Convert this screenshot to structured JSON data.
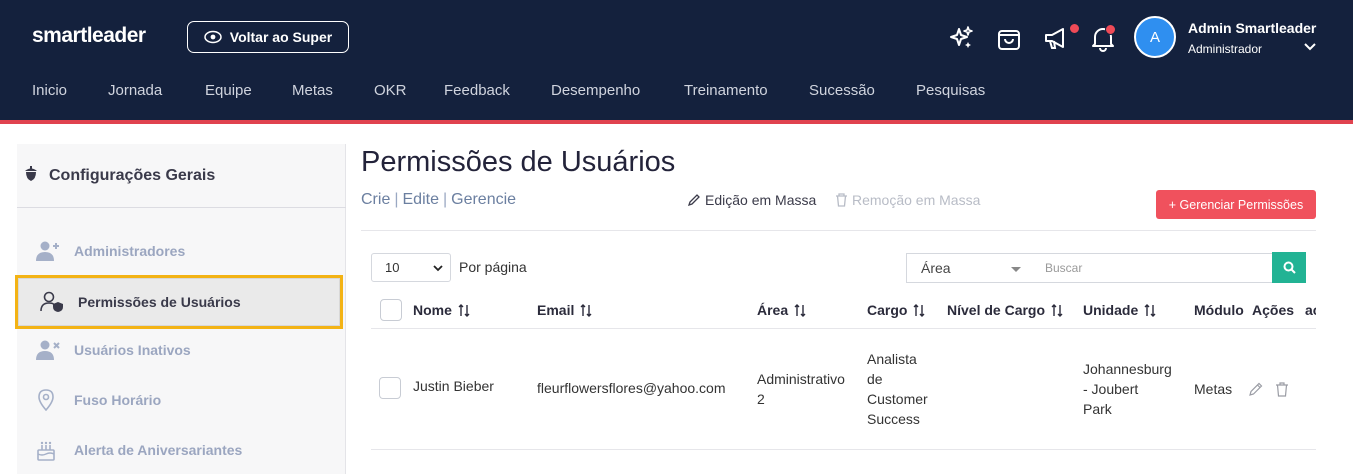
{
  "header": {
    "logo": "smartleader",
    "back_button": "Voltar ao Super",
    "icons": [
      "sparkle-icon",
      "shopping-bag-icon",
      "megaphone-icon",
      "bell-icon"
    ],
    "notification_color": "#ef4a57",
    "user": {
      "initial": "A",
      "name": "Admin Smartleader",
      "role": "Administrador"
    }
  },
  "nav": [
    "Inicio",
    "Jornada",
    "Equipe",
    "Metas",
    "OKR",
    "Feedback",
    "Desempenho",
    "Treinamento",
    "Sucessão",
    "Pesquisas"
  ],
  "sidebar": {
    "title": "Configurações Gerais",
    "items": [
      {
        "label": "Administradores",
        "icon": "user-plus-icon"
      },
      {
        "label": "Permissões de Usuários",
        "icon": "user-shield-icon",
        "active": true
      },
      {
        "label": "Usuários Inativos",
        "icon": "user-x-icon"
      },
      {
        "label": "Fuso Horário",
        "icon": "map-pin-icon"
      },
      {
        "label": "Alerta de Aniversariantes",
        "icon": "cake-icon"
      }
    ]
  },
  "main": {
    "title": "Permissões de Usuários",
    "breadcrumb": [
      "Crie",
      "Edite",
      "Gerencie"
    ],
    "mass_edit": "Edição em Massa",
    "mass_remove": "Remoção em Massa",
    "manage_button": "+ Gerenciar Permissões",
    "per_page": {
      "value": "10",
      "label": "Por página"
    },
    "area_filter": "Área",
    "search_placeholder": "Buscar",
    "columns": [
      "Nome",
      "Email",
      "Área",
      "Cargo",
      "Nível de Cargo",
      "Unidade",
      "Módulo",
      "Ações",
      "ac"
    ],
    "rows": [
      {
        "nome": "Justin Bieber",
        "email": "fleurflowersflores@yahoo.com",
        "area": [
          "Administrativo",
          "2"
        ],
        "cargo": [
          "Analista",
          "de",
          "Customer",
          "Success"
        ],
        "nivel": "",
        "unidade": [
          "Johannesburg",
          "- Joubert",
          "Park"
        ],
        "modulo": "Metas"
      }
    ]
  },
  "colors": {
    "header_bg": "#14213d",
    "accent_red": "#f0515d",
    "search_green": "#22b394",
    "active_outline": "#f3b315"
  }
}
